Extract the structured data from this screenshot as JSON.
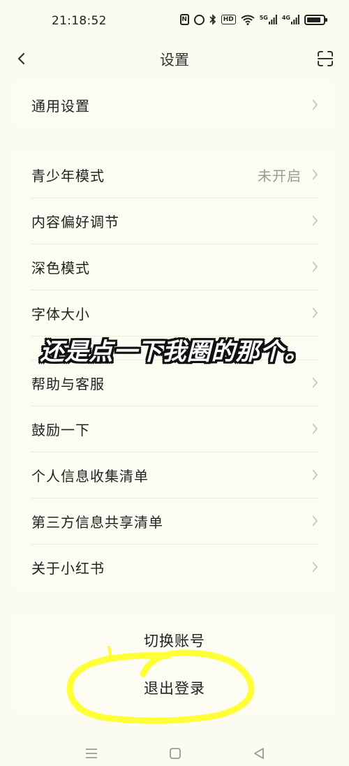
{
  "status_bar": {
    "time": "21:18:52",
    "nfc_label": "N",
    "hd_label": "HD",
    "network_1": "5G",
    "network_2": "4G",
    "icons": [
      "nfc-icon",
      "alarm-icon",
      "bluetooth-icon",
      "hd-icon",
      "wifi-icon",
      "signal-5g-icon",
      "signal-4g-icon",
      "battery-icon"
    ]
  },
  "nav": {
    "title": "设置"
  },
  "groups": {
    "general": [
      {
        "label": "通用设置",
        "value": ""
      }
    ],
    "main": [
      {
        "label": "青少年模式",
        "value": "未开启"
      },
      {
        "label": "内容偏好调节",
        "value": ""
      },
      {
        "label": "深色模式",
        "value": ""
      },
      {
        "label": "字体大小",
        "value": ""
      },
      {
        "label": "帮助与客服",
        "value": ""
      },
      {
        "label": "鼓励一下",
        "value": ""
      },
      {
        "label": "个人信息收集清单",
        "value": ""
      },
      {
        "label": "第三方信息共享清单",
        "value": ""
      },
      {
        "label": "关于小红书",
        "value": ""
      }
    ]
  },
  "account": {
    "switch_label": "切换账号",
    "logout_label": "退出登录"
  },
  "overlay": {
    "caption": "还是点一下我圈的那个。",
    "highlight_color": "#ffff22"
  },
  "colors": {
    "background": "#fbfbf0",
    "muted": "#9a9a90"
  }
}
